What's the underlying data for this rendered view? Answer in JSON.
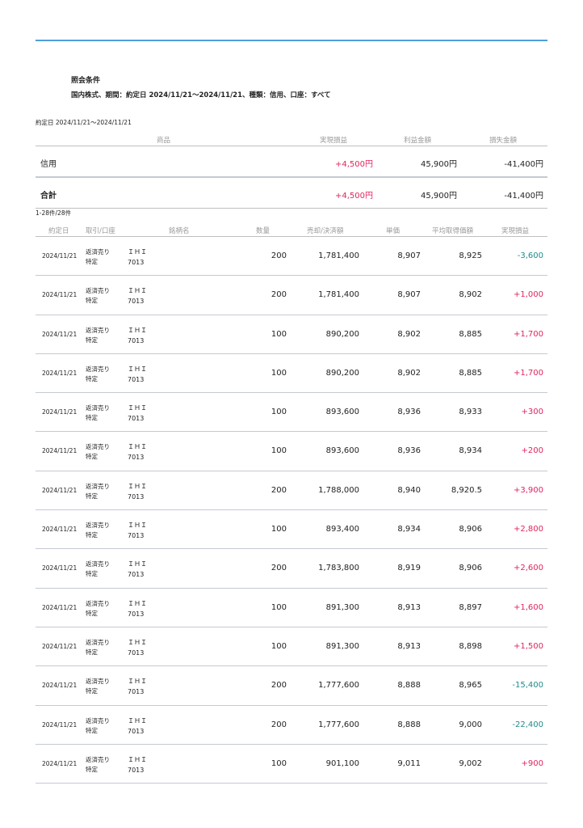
{
  "conditions": {
    "title": "照会条件",
    "text": "国内株式、期間：約定日 2024/11/21〜2024/11/21、種類：信用、口座：すべて"
  },
  "period": "約定日 2024/11/21〜2024/11/21",
  "summary": {
    "headers": {
      "product": "商品",
      "realized": "実現損益",
      "profit": "利益金額",
      "loss": "損失金額"
    },
    "rows": [
      {
        "label": "信用",
        "realized": "+4,500円",
        "profit": "45,900円",
        "loss": "-41,400円"
      },
      {
        "label": "合計",
        "realized": "+4,500円",
        "profit": "45,900円",
        "loss": "-41,400円"
      }
    ]
  },
  "count": "1-28件/28件",
  "table": {
    "headers": {
      "date": "約定日",
      "type": "取引/口座",
      "name": "銘柄名",
      "qty": "数量",
      "amount": "売却/決済額",
      "price": "単価",
      "avg": "平均取得価額",
      "pl": "実現損益"
    },
    "rows": [
      {
        "date": "2024/11/21",
        "trade": "返済売り",
        "account": "特定",
        "name": "ＩＨＩ",
        "code": "7013",
        "qty": "200",
        "amount": "1,781,400",
        "price": "8,907",
        "avg": "8,925",
        "pl": "-3,600",
        "pl_sign": "neg"
      },
      {
        "date": "2024/11/21",
        "trade": "返済売り",
        "account": "特定",
        "name": "ＩＨＩ",
        "code": "7013",
        "qty": "200",
        "amount": "1,781,400",
        "price": "8,907",
        "avg": "8,902",
        "pl": "+1,000",
        "pl_sign": "pos"
      },
      {
        "date": "2024/11/21",
        "trade": "返済売り",
        "account": "特定",
        "name": "ＩＨＩ",
        "code": "7013",
        "qty": "100",
        "amount": "890,200",
        "price": "8,902",
        "avg": "8,885",
        "pl": "+1,700",
        "pl_sign": "pos"
      },
      {
        "date": "2024/11/21",
        "trade": "返済売り",
        "account": "特定",
        "name": "ＩＨＩ",
        "code": "7013",
        "qty": "100",
        "amount": "890,200",
        "price": "8,902",
        "avg": "8,885",
        "pl": "+1,700",
        "pl_sign": "pos"
      },
      {
        "date": "2024/11/21",
        "trade": "返済売り",
        "account": "特定",
        "name": "ＩＨＩ",
        "code": "7013",
        "qty": "100",
        "amount": "893,600",
        "price": "8,936",
        "avg": "8,933",
        "pl": "+300",
        "pl_sign": "pos"
      },
      {
        "date": "2024/11/21",
        "trade": "返済売り",
        "account": "特定",
        "name": "ＩＨＩ",
        "code": "7013",
        "qty": "100",
        "amount": "893,600",
        "price": "8,936",
        "avg": "8,934",
        "pl": "+200",
        "pl_sign": "pos"
      },
      {
        "date": "2024/11/21",
        "trade": "返済売り",
        "account": "特定",
        "name": "ＩＨＩ",
        "code": "7013",
        "qty": "200",
        "amount": "1,788,000",
        "price": "8,940",
        "avg": "8,920.5",
        "pl": "+3,900",
        "pl_sign": "pos"
      },
      {
        "date": "2024/11/21",
        "trade": "返済売り",
        "account": "特定",
        "name": "ＩＨＩ",
        "code": "7013",
        "qty": "100",
        "amount": "893,400",
        "price": "8,934",
        "avg": "8,906",
        "pl": "+2,800",
        "pl_sign": "pos"
      },
      {
        "date": "2024/11/21",
        "trade": "返済売り",
        "account": "特定",
        "name": "ＩＨＩ",
        "code": "7013",
        "qty": "200",
        "amount": "1,783,800",
        "price": "8,919",
        "avg": "8,906",
        "pl": "+2,600",
        "pl_sign": "pos"
      },
      {
        "date": "2024/11/21",
        "trade": "返済売り",
        "account": "特定",
        "name": "ＩＨＩ",
        "code": "7013",
        "qty": "100",
        "amount": "891,300",
        "price": "8,913",
        "avg": "8,897",
        "pl": "+1,600",
        "pl_sign": "pos"
      },
      {
        "date": "2024/11/21",
        "trade": "返済売り",
        "account": "特定",
        "name": "ＩＨＩ",
        "code": "7013",
        "qty": "100",
        "amount": "891,300",
        "price": "8,913",
        "avg": "8,898",
        "pl": "+1,500",
        "pl_sign": "pos"
      },
      {
        "date": "2024/11/21",
        "trade": "返済売り",
        "account": "特定",
        "name": "ＩＨＩ",
        "code": "7013",
        "qty": "200",
        "amount": "1,777,600",
        "price": "8,888",
        "avg": "8,965",
        "pl": "-15,400",
        "pl_sign": "neg"
      },
      {
        "date": "2024/11/21",
        "trade": "返済売り",
        "account": "特定",
        "name": "ＩＨＩ",
        "code": "7013",
        "qty": "200",
        "amount": "1,777,600",
        "price": "8,888",
        "avg": "9,000",
        "pl": "-22,400",
        "pl_sign": "neg"
      },
      {
        "date": "2024/11/21",
        "trade": "返済売り",
        "account": "特定",
        "name": "ＩＨＩ",
        "code": "7013",
        "qty": "100",
        "amount": "901,100",
        "price": "9,011",
        "avg": "9,002",
        "pl": "+900",
        "pl_sign": "pos"
      }
    ]
  }
}
